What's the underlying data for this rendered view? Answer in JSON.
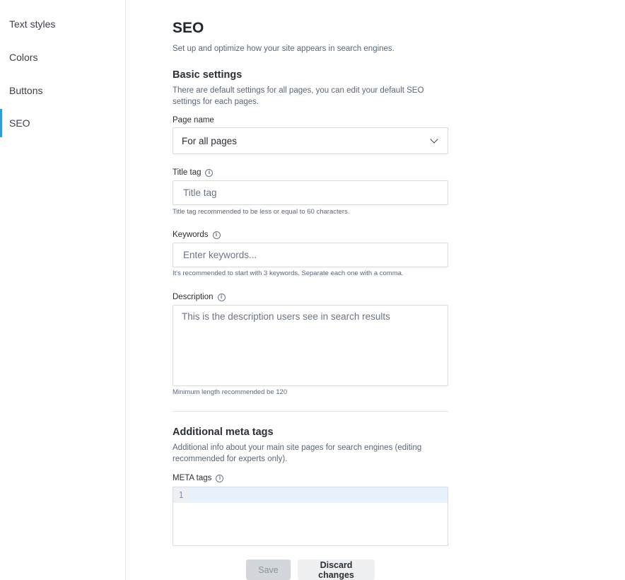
{
  "sidebar": {
    "items": [
      {
        "label": "Text styles"
      },
      {
        "label": "Colors"
      },
      {
        "label": "Buttons"
      },
      {
        "label": "SEO"
      }
    ]
  },
  "page": {
    "title": "SEO",
    "subtitle": "Set up and optimize how your site appears in search engines."
  },
  "basic": {
    "heading": "Basic settings",
    "description": "There are default settings for all pages, you can edit your default SEO settings for each pages.",
    "page_name_label": "Page name",
    "page_name_value": "For all pages",
    "title_tag_label": "Title tag",
    "title_tag_placeholder": "Title tag",
    "title_tag_hint": "Title tag recommended to be less or equal to 60 characters.",
    "keywords_label": "Keywords",
    "keywords_placeholder": "Enter keywords...",
    "keywords_hint": "It's recommended to start with 3 keywords. Separate each one with a comma.",
    "description_label": "Description",
    "description_placeholder": "This is the description users see in search results",
    "description_hint": "Minimum length recommended be 120"
  },
  "additional": {
    "heading": "Additional meta tags",
    "description": "Additional info about your main site pages for search engines (editing recommended for experts only).",
    "meta_label": "META tags",
    "line_number": "1"
  },
  "actions": {
    "save_label": "Save",
    "discard_label": "Discard changes"
  },
  "icons": {
    "info": "info-icon",
    "chevron": "chevron-down-icon"
  },
  "colors": {
    "accent": "#2a9fd8"
  }
}
